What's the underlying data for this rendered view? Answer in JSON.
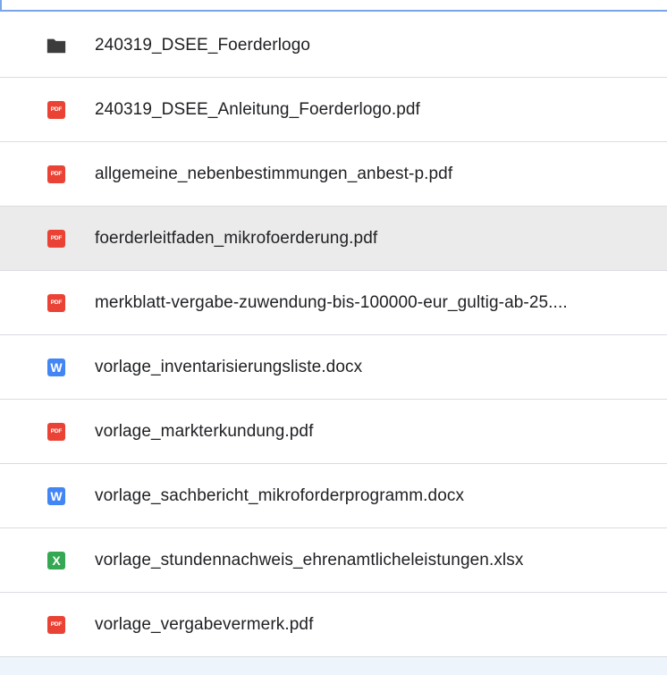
{
  "files": [
    {
      "name": "240319_DSEE_Foerderlogo",
      "type": "folder",
      "icon": "folder-icon",
      "badge": ""
    },
    {
      "name": "240319_DSEE_Anleitung_Foerderlogo.pdf",
      "type": "pdf",
      "icon": "pdf-icon",
      "badge": "PDF"
    },
    {
      "name": "allgemeine_nebenbestimmungen_anbest-p.pdf",
      "type": "pdf",
      "icon": "pdf-icon",
      "badge": "PDF"
    },
    {
      "name": "foerderleitfaden_mikrofoerderung.pdf",
      "type": "pdf",
      "icon": "pdf-icon",
      "badge": "PDF",
      "hover": true
    },
    {
      "name": "merkblatt-vergabe-zuwendung-bis-100000-eur_gultig-ab-25....",
      "type": "pdf",
      "icon": "pdf-icon",
      "badge": "PDF"
    },
    {
      "name": "vorlage_inventarisierungsliste.docx",
      "type": "doc",
      "icon": "word-doc-icon",
      "badge": "W"
    },
    {
      "name": "vorlage_markterkundung.pdf",
      "type": "pdf",
      "icon": "pdf-icon",
      "badge": "PDF"
    },
    {
      "name": "vorlage_sachbericht_mikroforderprogramm.docx",
      "type": "doc",
      "icon": "word-doc-icon",
      "badge": "W"
    },
    {
      "name": "vorlage_stundennachweis_ehrenamtlicheleistungen.xlsx",
      "type": "xls",
      "icon": "excel-sheet-icon",
      "badge": "X"
    },
    {
      "name": "vorlage_vergabevermerk.pdf",
      "type": "pdf",
      "icon": "pdf-icon",
      "badge": "PDF"
    }
  ],
  "colors": {
    "pdf": "#ea4335",
    "doc": "#4285f4",
    "xls": "#34a853",
    "folder": "#3c3c3c",
    "hover_row": "#ebebeb",
    "selection_border": "#7aa5e6"
  }
}
